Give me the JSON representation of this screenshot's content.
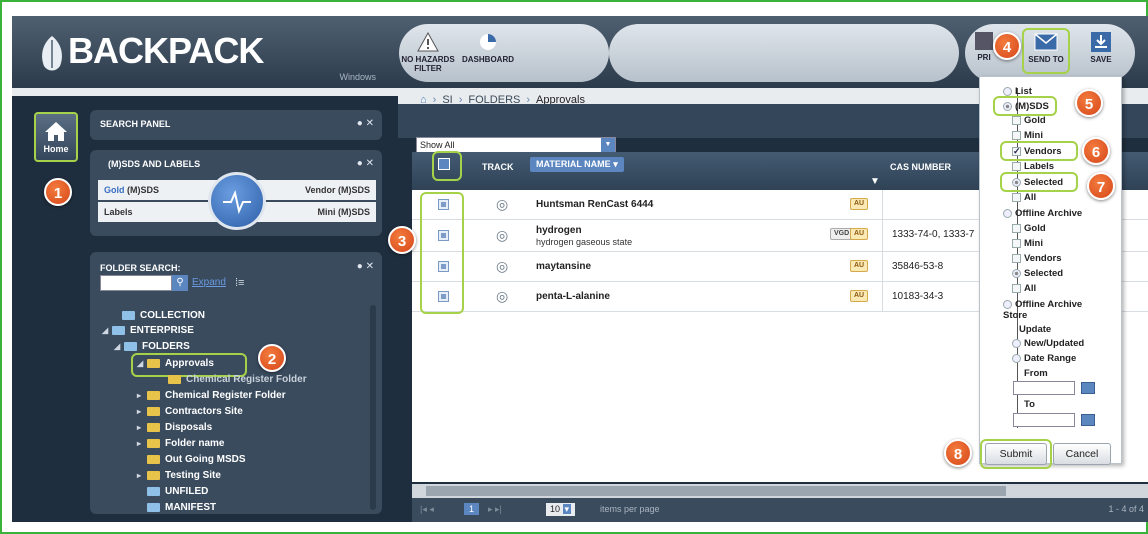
{
  "app": {
    "brand": "BACKPACK",
    "platform": "Windows",
    "toolbar": {
      "no_hazards_filter": "NO HAZARDS FILTER",
      "dashboard": "DASHBOARD",
      "print": "PRI",
      "send_to": "SEND TO",
      "save": "SAVE"
    },
    "breadcrumb": [
      "SI",
      "FOLDERS",
      "Approvals"
    ],
    "home_label": "Home"
  },
  "search_panel": {
    "title": "SEARCH PANEL"
  },
  "msds_panel": {
    "title": "(M)SDS AND LABELS",
    "gold": "Gold",
    "gold_suffix": "(M)SDS",
    "vendor": "Vendor (M)SDS",
    "labels": "Labels",
    "mini": "Mini (M)SDS"
  },
  "folder_search": {
    "title": "FOLDER SEARCH:",
    "expand": "Expand",
    "tree": [
      {
        "label": "COLLECTION"
      },
      {
        "label": "ENTERPRISE"
      },
      {
        "label": "FOLDERS"
      },
      {
        "label": "Approvals"
      },
      {
        "label": "Chemical Register Folder"
      },
      {
        "label": "Chemical Register Folder"
      },
      {
        "label": "Contractors Site"
      },
      {
        "label": "Disposals"
      },
      {
        "label": "Folder name"
      },
      {
        "label": "Out Going MSDS"
      },
      {
        "label": "Testing Site"
      },
      {
        "label": "UNFILED"
      },
      {
        "label": "MANIFEST"
      }
    ]
  },
  "grid": {
    "filter_value": "Show All",
    "columns": {
      "track": "TRACK",
      "material": "MATERIAL NAME",
      "cas": "CAS NUMBER"
    },
    "rows": [
      {
        "name": "Huntsman RenCast 6444",
        "desc": "",
        "cas": "",
        "badges": [
          "AU"
        ]
      },
      {
        "name": "hydrogen",
        "desc": "hydrogen gaseous state",
        "cas": "1333-74-0, 1333-7",
        "badges": [
          "VGD",
          "AU"
        ]
      },
      {
        "name": "maytansine",
        "desc": "",
        "cas": "35846-53-8",
        "badges": [
          "AU"
        ]
      },
      {
        "name": "penta-L-alanine",
        "desc": "",
        "cas": "10183-34-3",
        "badges": [
          "AU"
        ]
      }
    ],
    "pager": {
      "page": "1",
      "per_page": "10",
      "items_label": "items per page",
      "range": "1 - 4 of 4"
    }
  },
  "send_menu": {
    "list": "List",
    "msds": "(M)SDS",
    "gold": "Gold",
    "mini": "Mini",
    "vendors": "Vendors",
    "labels": "Labels",
    "selected": "Selected",
    "all": "All",
    "offline_archive": "Offline Archive",
    "oa_gold": "Gold",
    "oa_mini": "Mini",
    "oa_vendors": "Vendors",
    "oa_selected": "Selected",
    "oa_all": "All",
    "offline_archive_store": "Offline Archive Store",
    "update": "Update",
    "new_updated": "New/Updated",
    "date_range": "Date Range",
    "from": "From",
    "to": "To",
    "submit": "Submit",
    "cancel": "Cancel"
  },
  "callouts": [
    "1",
    "2",
    "3",
    "4",
    "5",
    "6",
    "7",
    "8"
  ],
  "colors": {
    "highlight": "#a6d24a",
    "callout": "#e0571e",
    "app_dark": "#1f2e3e"
  }
}
